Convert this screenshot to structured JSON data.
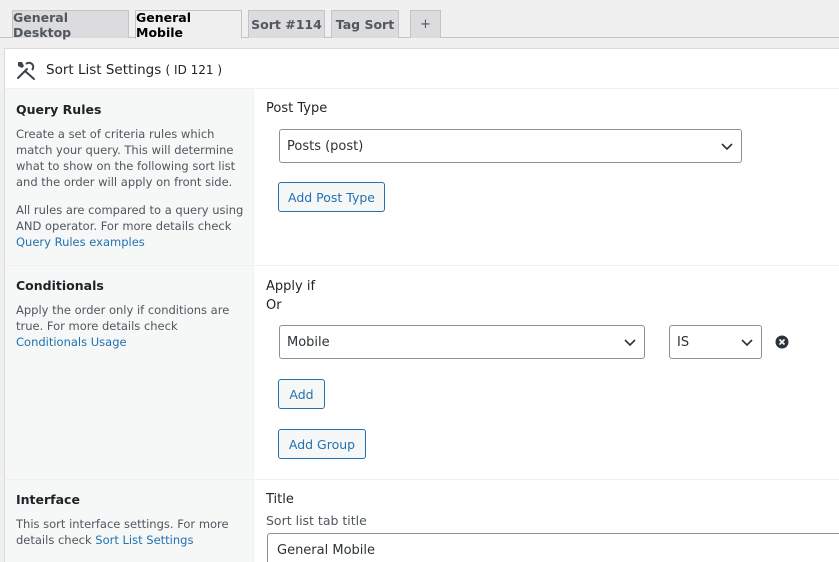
{
  "tabs": [
    {
      "label": "General Desktop",
      "active": false
    },
    {
      "label": "General Mobile",
      "active": true
    },
    {
      "label": "Sort #114",
      "active": false
    },
    {
      "label": "Tag Sort",
      "active": false
    },
    {
      "label": "+",
      "active": false
    }
  ],
  "header": {
    "icon": "tools-icon",
    "title": "Sort List Settings",
    "id_text": "( ID 121 )"
  },
  "query_rules": {
    "title": "Query Rules",
    "desc1": "Create a set of criteria rules which match your query. This will determine what to show on the following sort list and the order will apply on front side.",
    "desc2": "All rules are compared to a query using AND operator. For more details check",
    "link": "Query Rules examples",
    "post_type_label": "Post Type",
    "post_type_value": "Posts (post)",
    "add_post_type": "Add Post Type"
  },
  "conditionals": {
    "title": "Conditionals",
    "desc": "Apply the order only if conditions are true. For more details check",
    "link": "Conditionals Usage",
    "apply_if": "Apply if",
    "or_label": "Or",
    "condition_value": "Mobile",
    "operator_value": "IS",
    "add": "Add",
    "add_group": "Add Group"
  },
  "interface": {
    "title": "Interface",
    "desc": "This sort interface settings. For more details check",
    "link": "Sort List Settings",
    "title_label": "Title",
    "title_sub": "Sort list tab title",
    "title_value": "General Mobile"
  }
}
